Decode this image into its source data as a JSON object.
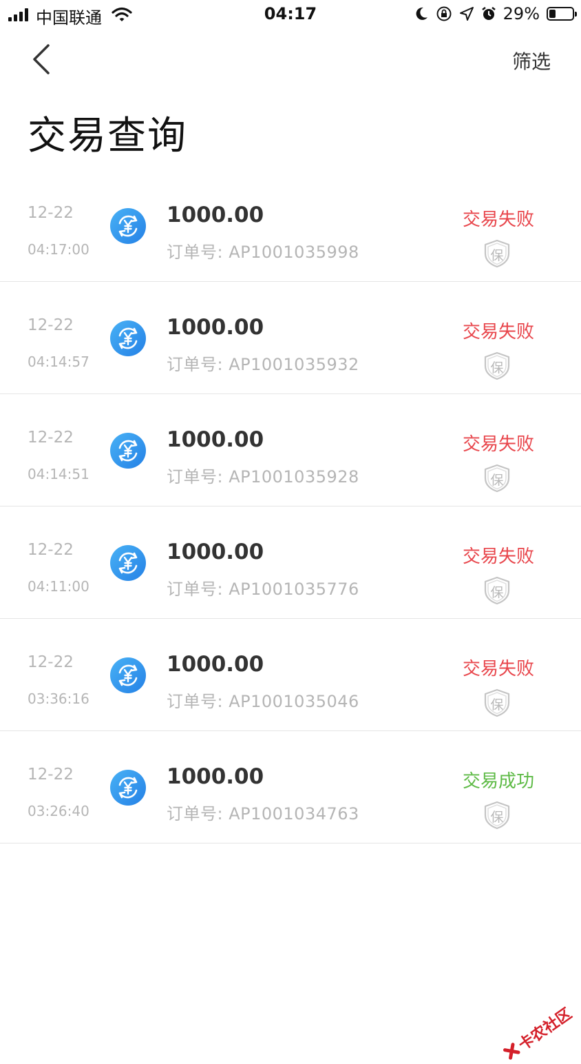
{
  "status_bar": {
    "carrier": "中国联通",
    "time": "04:17",
    "battery_percent": "29%",
    "battery_level": 0.29,
    "icons": [
      "signal-icon",
      "wifi-icon",
      "moon-icon",
      "rotation-lock-icon",
      "location-icon",
      "alarm-icon",
      "battery-icon"
    ]
  },
  "nav": {
    "back_icon": "chevron-left-icon",
    "filter_label": "筛选"
  },
  "page": {
    "title": "交易查询"
  },
  "colors": {
    "failed": "#e8454b",
    "success": "#5dba45",
    "accent_blue": "#2f8ff0",
    "muted": "#b5b5b5"
  },
  "transactions": [
    {
      "date": "12-22",
      "time": "04:17:00",
      "amount": "1000.00",
      "order": "订单号: AP1001035998",
      "status": "交易失败",
      "state": "failed",
      "shield_char": "保"
    },
    {
      "date": "12-22",
      "time": "04:14:57",
      "amount": "1000.00",
      "order": "订单号: AP1001035932",
      "status": "交易失败",
      "state": "failed",
      "shield_char": "保"
    },
    {
      "date": "12-22",
      "time": "04:14:51",
      "amount": "1000.00",
      "order": "订单号: AP1001035928",
      "status": "交易失败",
      "state": "failed",
      "shield_char": "保"
    },
    {
      "date": "12-22",
      "time": "04:11:00",
      "amount": "1000.00",
      "order": "订单号: AP1001035776",
      "status": "交易失败",
      "state": "failed",
      "shield_char": "保"
    },
    {
      "date": "12-22",
      "time": "03:36:16",
      "amount": "1000.00",
      "order": "订单号: AP1001035046",
      "status": "交易失败",
      "state": "failed",
      "shield_char": "保"
    },
    {
      "date": "12-22",
      "time": "03:26:40",
      "amount": "1000.00",
      "order": "订单号: AP1001034763",
      "status": "交易成功",
      "state": "success",
      "shield_char": "保"
    }
  ],
  "watermark": {
    "text": "卡农社区"
  }
}
